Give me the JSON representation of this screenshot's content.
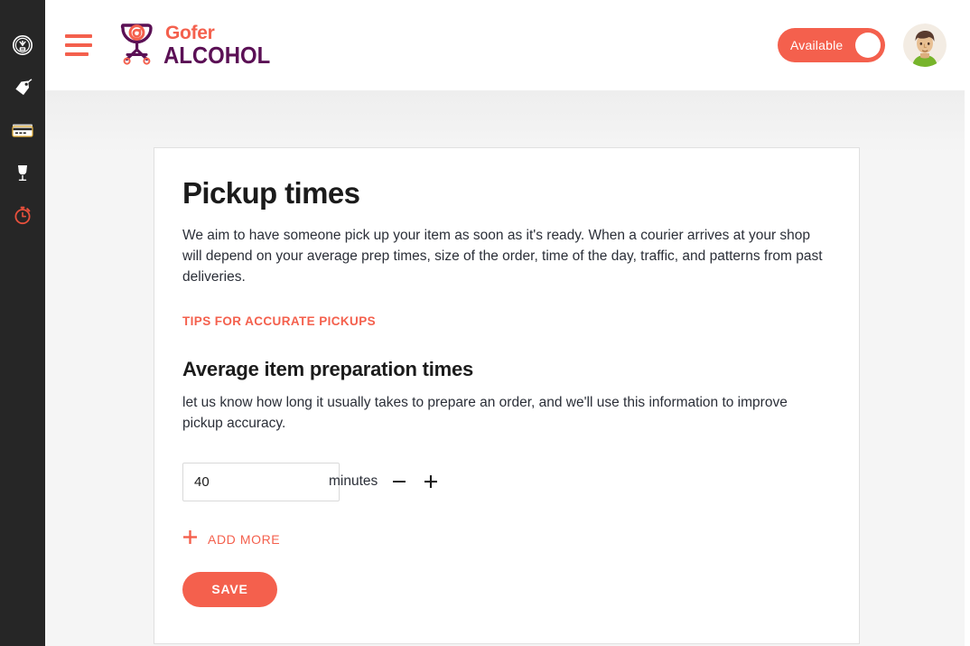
{
  "sidebar": {
    "items": [
      {
        "icon": "dashboard-gauge-icon",
        "name": "dashboard",
        "active": false
      },
      {
        "icon": "tag-icon",
        "name": "offers",
        "active": false
      },
      {
        "icon": "credit-card-icon",
        "name": "payments",
        "active": false
      },
      {
        "icon": "wine-glass-icon",
        "name": "catalog",
        "active": false
      },
      {
        "icon": "stopwatch-icon",
        "name": "pickup-times",
        "active": true
      }
    ]
  },
  "header": {
    "menu_icon": "hamburger-menu-icon",
    "logo": {
      "mark": "wine-glass-scooter-logo-icon",
      "line1": "Gofer",
      "line2": "ALCOHOL"
    },
    "availability": {
      "label": "Available",
      "state": "on"
    },
    "avatar": "user-avatar"
  },
  "card": {
    "title": "Pickup times",
    "intro": "We aim to have someone pick up your item as soon as it's ready. When a courier arrives at your shop will depend on your average prep times, size of the order, time of the day, traffic, and patterns from past deliveries.",
    "tips_link": "TIPS FOR ACCURATE PICKUPS",
    "section_title": "Average item preparation times",
    "section_desc": "let us know how long it usually takes to prepare an order, and we'll use this information to improve pickup accuracy.",
    "prep_time": {
      "value": "40",
      "placeholder": "0",
      "unit": "minutes",
      "decrease_icon": "minus-icon",
      "increase_icon": "plus-icon"
    },
    "add_more": {
      "icon": "plus-icon",
      "label": "ADD MORE"
    },
    "save_label": "SAVE"
  },
  "colors": {
    "accent": "#f4604d",
    "sidebar_bg": "#262626",
    "logo_purple": "#5b1055",
    "content_bg": "#f5f5f5",
    "text": "#1b1b1b"
  }
}
